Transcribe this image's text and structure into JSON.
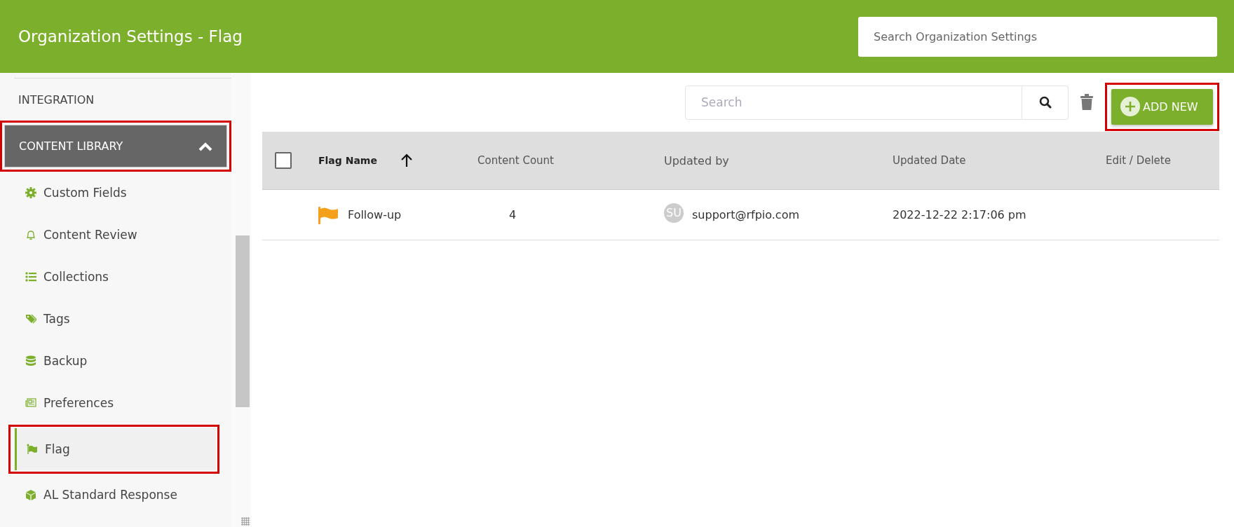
{
  "header": {
    "title": "Organization Settings - Flag",
    "search": {
      "placeholder": "Search Organization Settings"
    }
  },
  "sidebar": {
    "top_item": "INTEGRATION",
    "section": {
      "label": "CONTENT LIBRARY",
      "expanded": true,
      "highlighted": true
    },
    "items": [
      {
        "label": "Custom Fields",
        "selected": false,
        "highlighted": false
      },
      {
        "label": "Content Review",
        "selected": false,
        "highlighted": false
      },
      {
        "label": "Collections",
        "selected": false,
        "highlighted": false
      },
      {
        "label": "Tags",
        "selected": false,
        "highlighted": false
      },
      {
        "label": "Backup",
        "selected": false,
        "highlighted": false
      },
      {
        "label": "Preferences",
        "selected": false,
        "highlighted": false
      },
      {
        "label": "Flag",
        "selected": true,
        "highlighted": true
      },
      {
        "label": "AL Standard Response",
        "selected": false,
        "highlighted": false
      }
    ]
  },
  "toolbar": {
    "search": {
      "placeholder": "Search"
    },
    "add_button": {
      "label": "ADD NEW",
      "highlighted": true
    }
  },
  "table": {
    "select_all": {
      "checked": false
    },
    "columns": [
      {
        "label": "Flag Name",
        "sorted": true
      },
      {
        "label": "Content Count",
        "sorted": false
      },
      {
        "label": "Updated by",
        "sorted": false
      },
      {
        "label": "Updated Date",
        "sorted": false
      },
      {
        "label": "Edit / Delete",
        "sorted": false
      }
    ],
    "rows": [
      {
        "name": "Follow-up",
        "color": "#f5a01a",
        "count": "4",
        "avatar": "SU",
        "updated_by": "support@rfpio.com",
        "updated_date": "2022-12-22 2:17:06 pm"
      }
    ]
  }
}
